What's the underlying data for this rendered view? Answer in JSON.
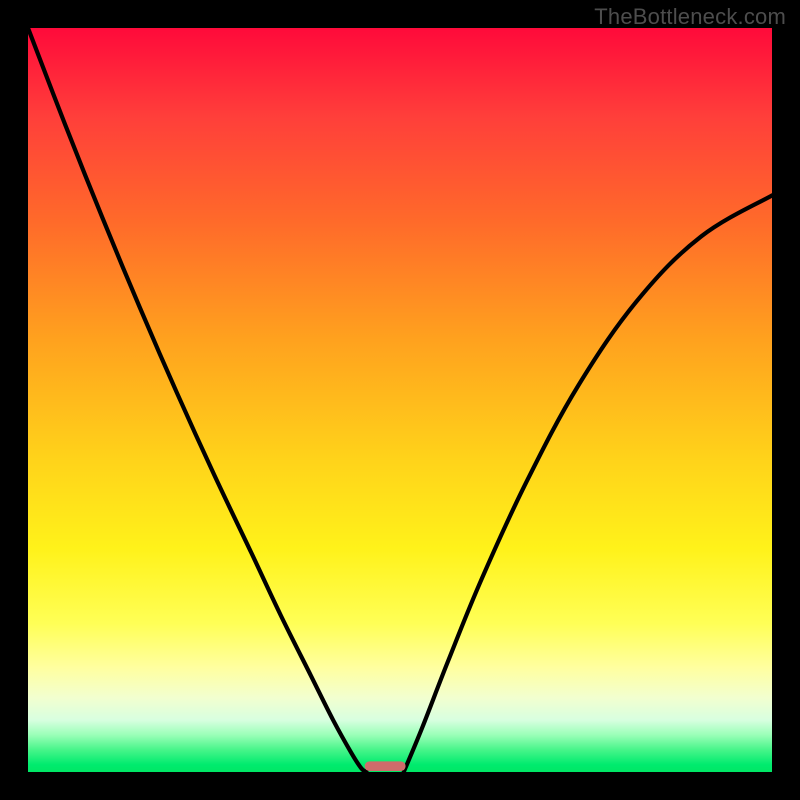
{
  "attribution": "TheBottleneck.com",
  "chart_data": {
    "type": "line",
    "title": "",
    "xlabel": "",
    "ylabel": "",
    "xlim": [
      0,
      1
    ],
    "ylim": [
      0,
      1
    ],
    "series": [
      {
        "name": "left-curve",
        "x": [
          0.0,
          0.05,
          0.1,
          0.15,
          0.2,
          0.25,
          0.3,
          0.34,
          0.38,
          0.41,
          0.435,
          0.448,
          0.455
        ],
        "y": [
          1.0,
          0.87,
          0.745,
          0.625,
          0.51,
          0.4,
          0.295,
          0.21,
          0.13,
          0.07,
          0.025,
          0.005,
          0.0
        ]
      },
      {
        "name": "right-curve",
        "x": [
          0.505,
          0.53,
          0.565,
          0.61,
          0.67,
          0.74,
          0.82,
          0.905,
          1.0
        ],
        "y": [
          0.0,
          0.06,
          0.15,
          0.26,
          0.39,
          0.52,
          0.635,
          0.72,
          0.775
        ]
      }
    ],
    "marker": {
      "name": "bottom-marker",
      "x_center": 0.48,
      "width": 0.055,
      "height": 0.013,
      "color": "#cf6b6b"
    },
    "background": {
      "style": "vertical-gradient",
      "stops": [
        {
          "pos": 0.0,
          "color": "#ff0a3a"
        },
        {
          "pos": 0.5,
          "color": "#ffc81a"
        },
        {
          "pos": 0.8,
          "color": "#ffff56"
        },
        {
          "pos": 1.0,
          "color": "#00e765"
        }
      ]
    }
  }
}
